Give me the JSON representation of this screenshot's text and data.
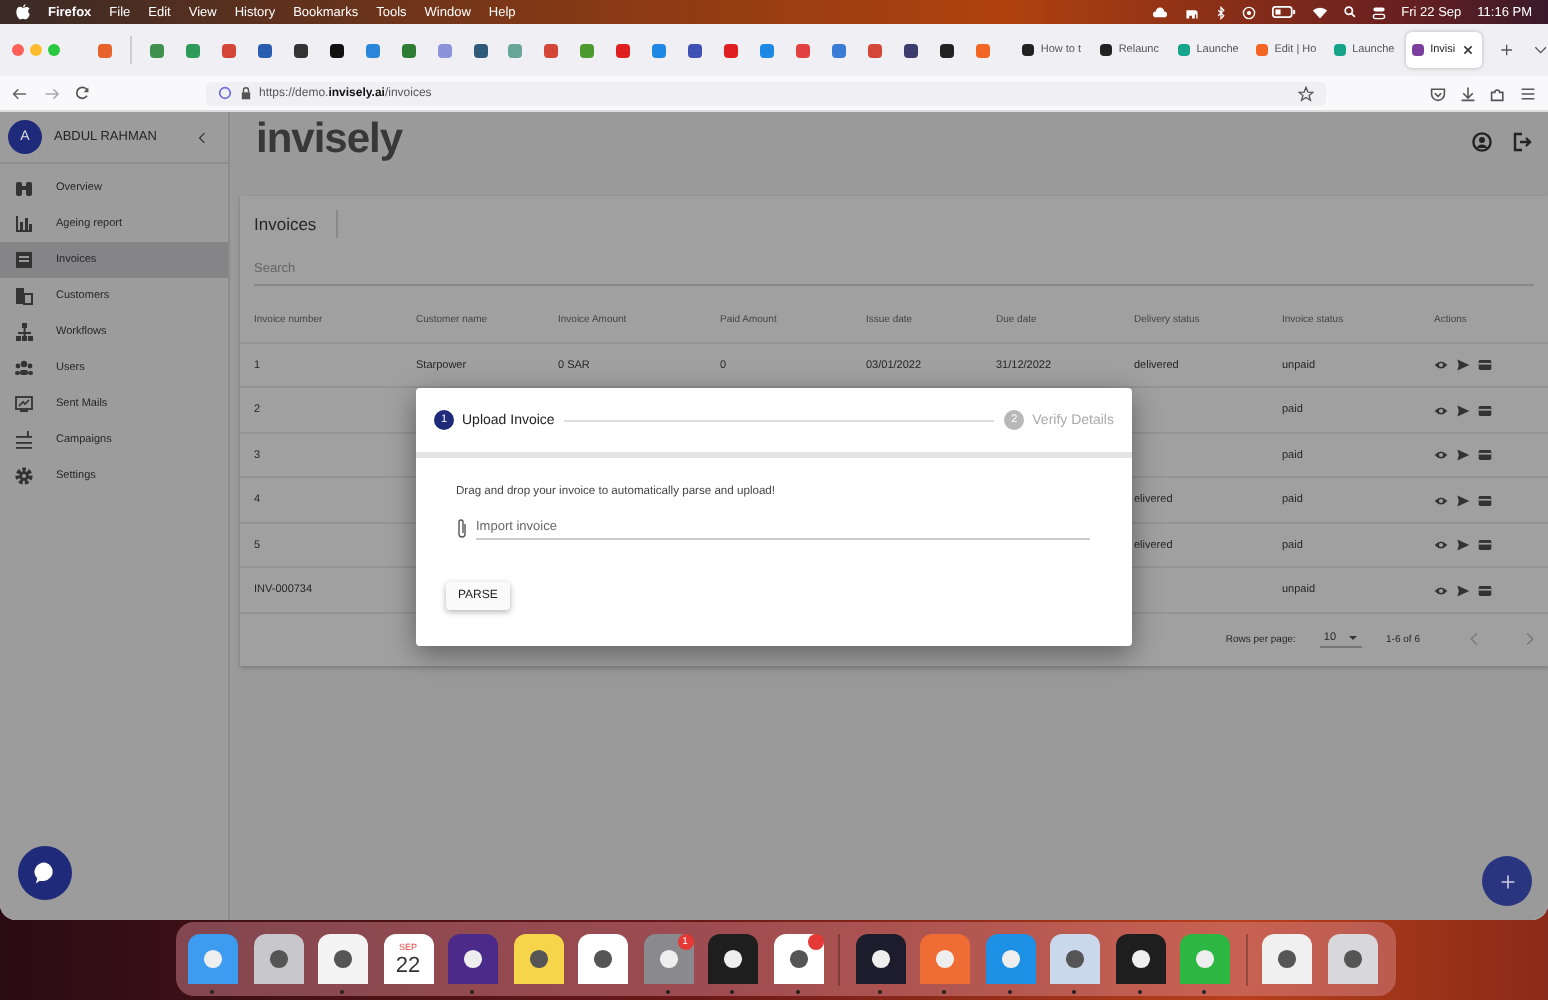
{
  "menubar": {
    "app": "Firefox",
    "menus": [
      "File",
      "Edit",
      "View",
      "History",
      "Bookmarks",
      "Tools",
      "Window",
      "Help"
    ],
    "date": "Fri 22 Sep",
    "time": "11:16 PM"
  },
  "browser": {
    "pinned_tabs": [
      {
        "color": "#e8622c"
      },
      {
        "color": "#3f8f4f"
      },
      {
        "color": "#2e9a5a"
      },
      {
        "color": "#d44638"
      },
      {
        "color": "#2a5db0"
      },
      {
        "color": "#333333"
      },
      {
        "color": "#111111"
      },
      {
        "color": "#2a86d8"
      },
      {
        "color": "#2f7d32"
      },
      {
        "color": "#8a94d8"
      },
      {
        "color": "#2f5a7a"
      },
      {
        "color": "#6aa59a"
      },
      {
        "color": "#d44638"
      },
      {
        "color": "#4f9a2f"
      },
      {
        "color": "#e02020"
      },
      {
        "color": "#1e88e5"
      },
      {
        "color": "#3f51b5"
      },
      {
        "color": "#e02020"
      },
      {
        "color": "#1e88e5"
      },
      {
        "color": "#e04040"
      },
      {
        "color": "#3a7bd5"
      },
      {
        "color": "#d44638"
      },
      {
        "color": "#3c3c6c"
      },
      {
        "color": "#222222"
      },
      {
        "color": "#f26522"
      }
    ],
    "tabs": [
      {
        "title": "How to t",
        "color": "#222222",
        "selected": false
      },
      {
        "title": "Relaunc",
        "color": "#222222",
        "selected": false
      },
      {
        "title": "Launche",
        "color": "#17a589",
        "selected": false
      },
      {
        "title": "Edit | Ho",
        "color": "#f26522",
        "selected": false
      },
      {
        "title": "Launche",
        "color": "#17a589",
        "selected": false
      },
      {
        "title": "Invisi",
        "color": "#7b3fa0",
        "selected": true
      }
    ],
    "url": "https://demo.**invisely.ai**/invoices"
  },
  "sidebar": {
    "user": {
      "initial": "A",
      "name": "ABDUL RAHMAN"
    },
    "items": [
      {
        "label": "Overview",
        "selected": false
      },
      {
        "label": "Ageing report",
        "selected": false
      },
      {
        "label": "Invoices",
        "selected": true
      },
      {
        "label": "Customers",
        "selected": false
      },
      {
        "label": "Workflows",
        "selected": false
      },
      {
        "label": "Users",
        "selected": false
      },
      {
        "label": "Sent Mails",
        "selected": false
      },
      {
        "label": "Campaigns",
        "selected": false
      },
      {
        "label": "Settings",
        "selected": false
      }
    ]
  },
  "logo": "invisely",
  "invoices": {
    "title": "Invoices",
    "search": {
      "placeholder": "Search"
    },
    "columns": [
      "Invoice number",
      "Customer name",
      "Invoice Amount",
      "Paid Amount",
      "Issue date",
      "Due date",
      "Delivery status",
      "Invoice status",
      "Actions"
    ],
    "rows": [
      {
        "number": "1",
        "customer": "Starpower",
        "amount": "0 SAR",
        "paid": "0",
        "issue_date": "03/01/2022",
        "due_date": "31/12/2022",
        "delivery_status": "delivered",
        "invoice_status": "unpaid"
      },
      {
        "number": "2",
        "invoice_status": "paid"
      },
      {
        "number": "3",
        "invoice_status": "paid"
      },
      {
        "number": "4",
        "delivery_status": "elivered",
        "invoice_status": "paid"
      },
      {
        "number": "5",
        "delivery_status": "elivered",
        "invoice_status": "paid"
      },
      {
        "number": "INV-000734",
        "invoice_status": "unpaid"
      }
    ],
    "pagination": {
      "rows_per_page_label": "Rows per page:",
      "rows_per_page": "10",
      "range": "1-6 of 6"
    }
  },
  "dialog": {
    "steps": [
      {
        "number": "1",
        "label": "Upload Invoice",
        "selected": true
      },
      {
        "number": "2",
        "label": "Verify Details",
        "selected": false
      }
    ],
    "instruction": "Drag and drop your invoice to automatically parse and upload!",
    "file_field": {
      "placeholder": "Import invoice"
    },
    "button": "PARSE"
  },
  "dock": {
    "apps": [
      {
        "kind": "app",
        "color": "#3d9cf0",
        "running": true,
        "alert": false
      },
      {
        "kind": "app",
        "color": "#c8c8cc",
        "running": false,
        "alert": false
      },
      {
        "kind": "app",
        "color": "#f4f4f4",
        "running": true,
        "alert": false
      },
      {
        "kind": "calendar",
        "month": "SEP",
        "day": "22",
        "color": "#ffffff",
        "running": false,
        "alert": false
      },
      {
        "kind": "app",
        "color": "#4b2a8a",
        "running": true,
        "alert": false
      },
      {
        "kind": "app",
        "color": "#f7d54a",
        "running": false,
        "alert": false
      },
      {
        "kind": "app",
        "color": "#ffffff",
        "running": false,
        "alert": false
      },
      {
        "kind": "app",
        "color": "#8a8a8e",
        "running": true,
        "alert": true,
        "badge": "1"
      },
      {
        "kind": "app",
        "color": "#1e1e1e",
        "running": true,
        "alert": false
      },
      {
        "kind": "app",
        "color": "#ffffff",
        "running": true,
        "alert": true
      },
      {
        "kind": "app",
        "color": "#1c1c2c",
        "running": true,
        "alert": false
      },
      {
        "kind": "app",
        "color": "#ef6c35",
        "running": true,
        "alert": false
      },
      {
        "kind": "app",
        "color": "#1d91e6",
        "running": true,
        "alert": false
      },
      {
        "kind": "app",
        "color": "#c9d8ea",
        "running": true,
        "alert": false
      },
      {
        "kind": "app",
        "color": "#1e1e1e",
        "running": true,
        "alert": false
      },
      {
        "kind": "app",
        "color": "#2bb741",
        "running": true,
        "alert": false
      },
      {
        "kind": "app",
        "color": "#f0f0f0",
        "running": false,
        "alert": false
      },
      {
        "kind": "app",
        "color": "#d8d8dc",
        "running": false,
        "alert": false
      }
    ]
  }
}
